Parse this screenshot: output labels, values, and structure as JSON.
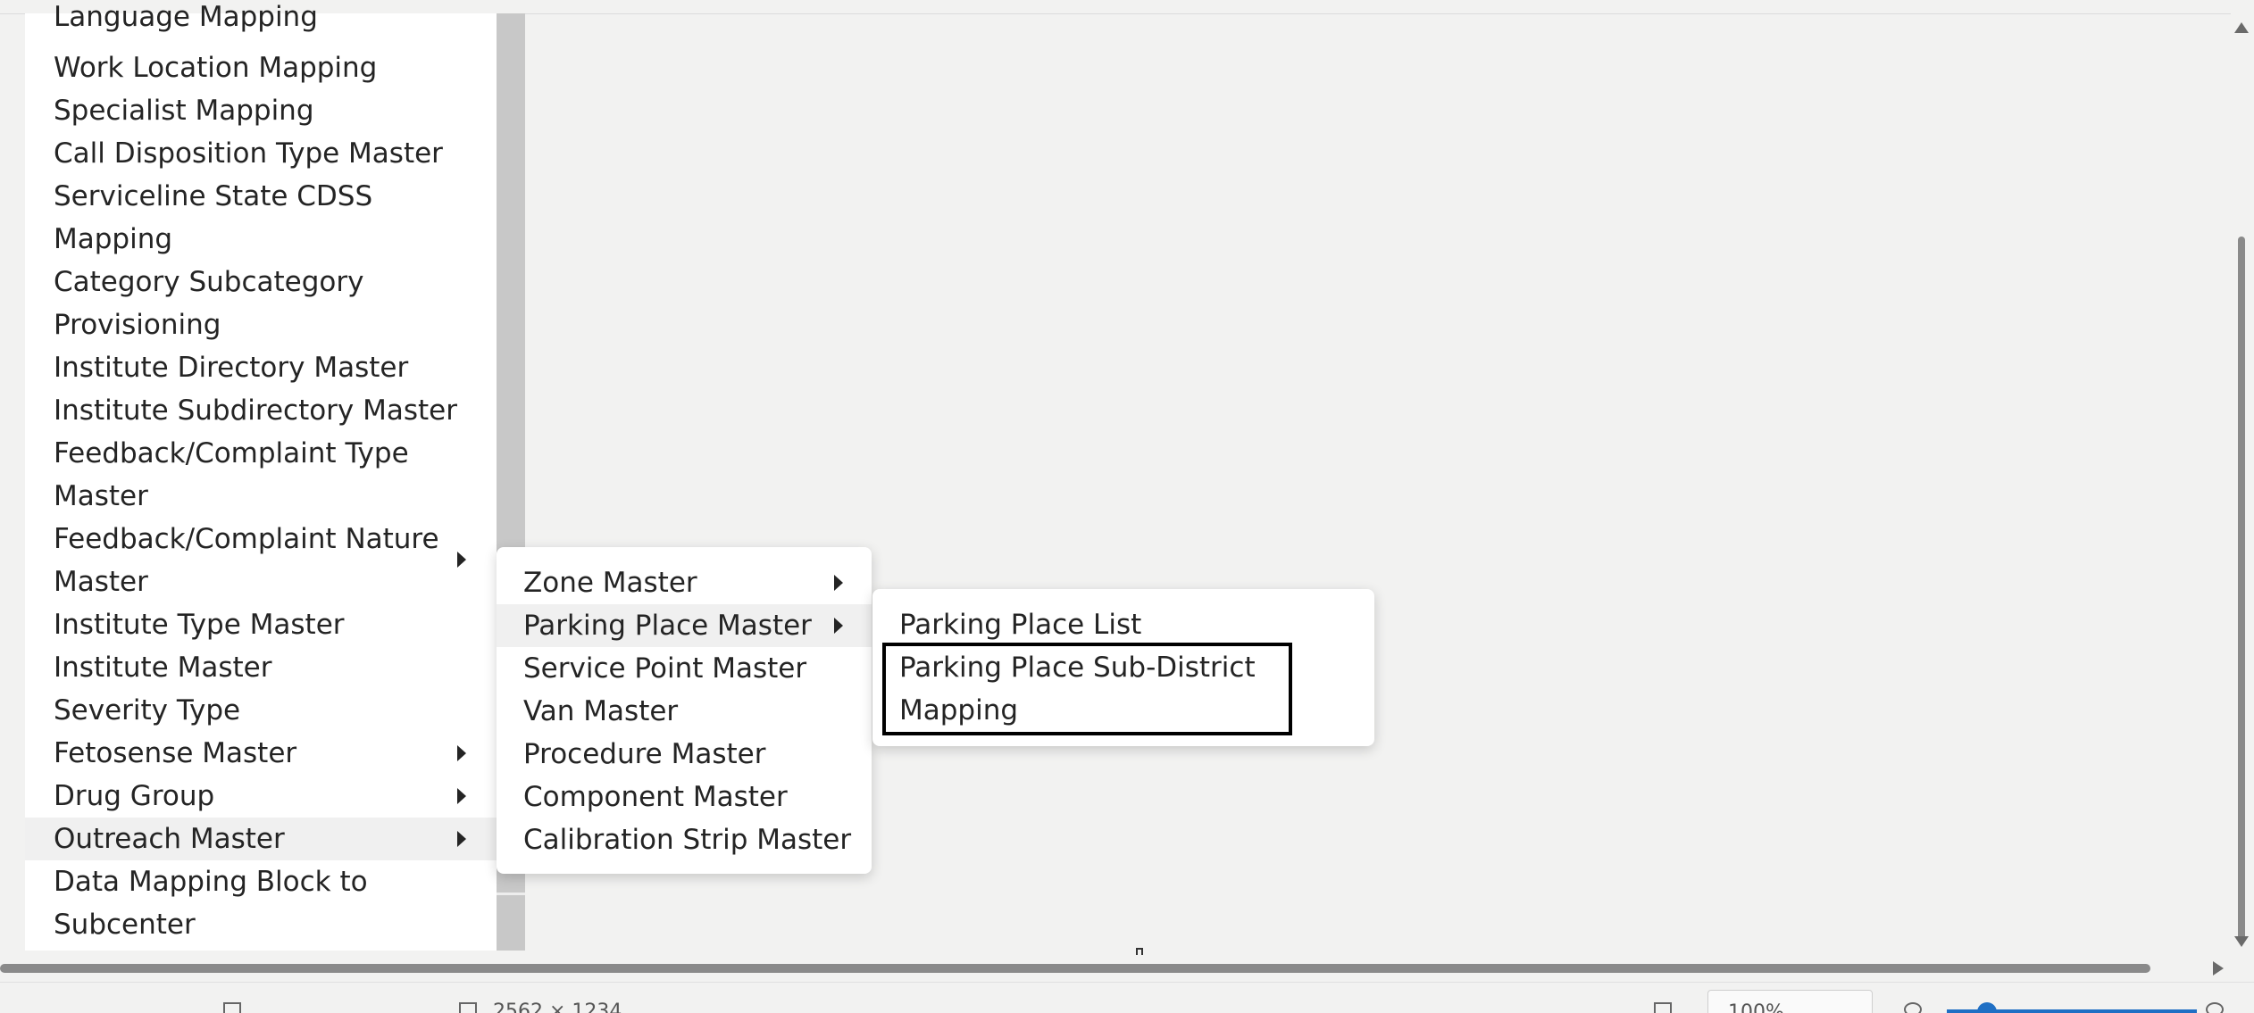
{
  "main_menu": {
    "items": [
      {
        "label": "Language Mapping"
      },
      {
        "label": "Work Location Mapping"
      },
      {
        "label": "Specialist Mapping"
      },
      {
        "label": "Call Disposition Type Master"
      },
      {
        "label": "Serviceline State CDSS Mapping"
      },
      {
        "label": "Category Subcategory Provisioning"
      },
      {
        "label": "Institute Directory Master"
      },
      {
        "label": "Institute Subdirectory Master"
      },
      {
        "label": "Feedback/Complaint Type Master"
      },
      {
        "label": "Feedback/Complaint Nature Master"
      },
      {
        "label": "Institute Type Master"
      },
      {
        "label": "Institute Master"
      },
      {
        "label": "Severity Type"
      },
      {
        "label": "Fetosense Master"
      },
      {
        "label": "Drug Group"
      },
      {
        "label": "Outreach Master"
      },
      {
        "label": "Data Mapping Block to Subcenter"
      }
    ]
  },
  "outreach_submenu": {
    "items": [
      {
        "label": "Zone Master"
      },
      {
        "label": "Parking Place Master"
      },
      {
        "label": "Service Point Master"
      },
      {
        "label": "Van Master"
      },
      {
        "label": "Procedure Master"
      },
      {
        "label": "Component Master"
      },
      {
        "label": "Calibration Strip Master"
      }
    ]
  },
  "parking_submenu": {
    "items": [
      {
        "label": "Parking Place List"
      },
      {
        "label": "Parking Place Sub-District Mapping"
      }
    ]
  },
  "status_bar": {
    "dimensions": "2562 × 1234",
    "zoom": "100%"
  },
  "colors": {
    "background": "#f2f2f1",
    "menu_bg": "#ffffff",
    "active_item": "#f0f0f0",
    "focus_border": "#000000",
    "accent": "#1f6fc4"
  }
}
